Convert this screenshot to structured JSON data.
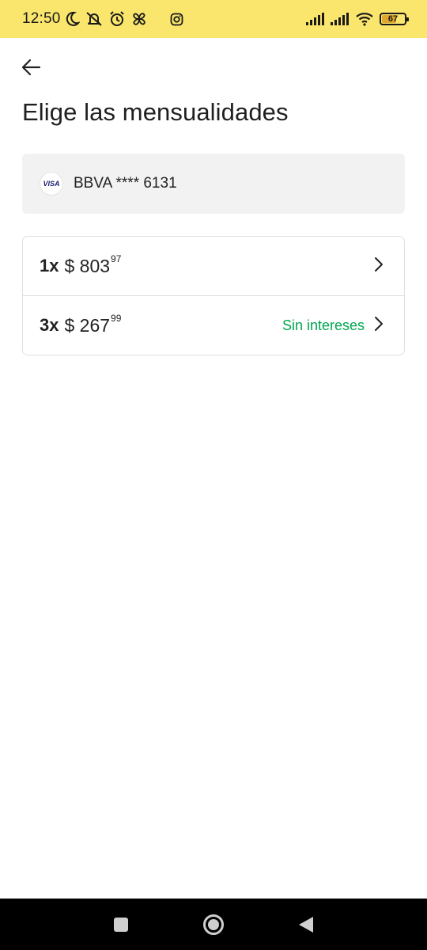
{
  "status_bar": {
    "time": "12:50",
    "battery": "67",
    "battery_level": 0.67,
    "icons": [
      "moon-icon",
      "bell-muted-icon",
      "alarm-icon",
      "pinwheel-icon",
      "instagram-icon",
      "signal-icon",
      "signal-icon",
      "wifi-icon",
      "battery-icon"
    ]
  },
  "header": {
    "back_icon": "arrow-left-icon",
    "title": "Elige las mensualidades"
  },
  "card": {
    "brand": "VISA",
    "label": "BBVA **** 6131"
  },
  "options": [
    {
      "count": "1x",
      "currency": "$",
      "amount": "803",
      "cents": "97",
      "tag": ""
    },
    {
      "count": "3x",
      "currency": "$",
      "amount": "267",
      "cents": "99",
      "tag": "Sin intereses"
    }
  ],
  "colors": {
    "status_bar": "#fbe66d",
    "accent_green": "#00a650",
    "card_bg": "#f2f2f2"
  },
  "nav": [
    "recents-icon",
    "home-icon",
    "back-triangle-icon"
  ]
}
